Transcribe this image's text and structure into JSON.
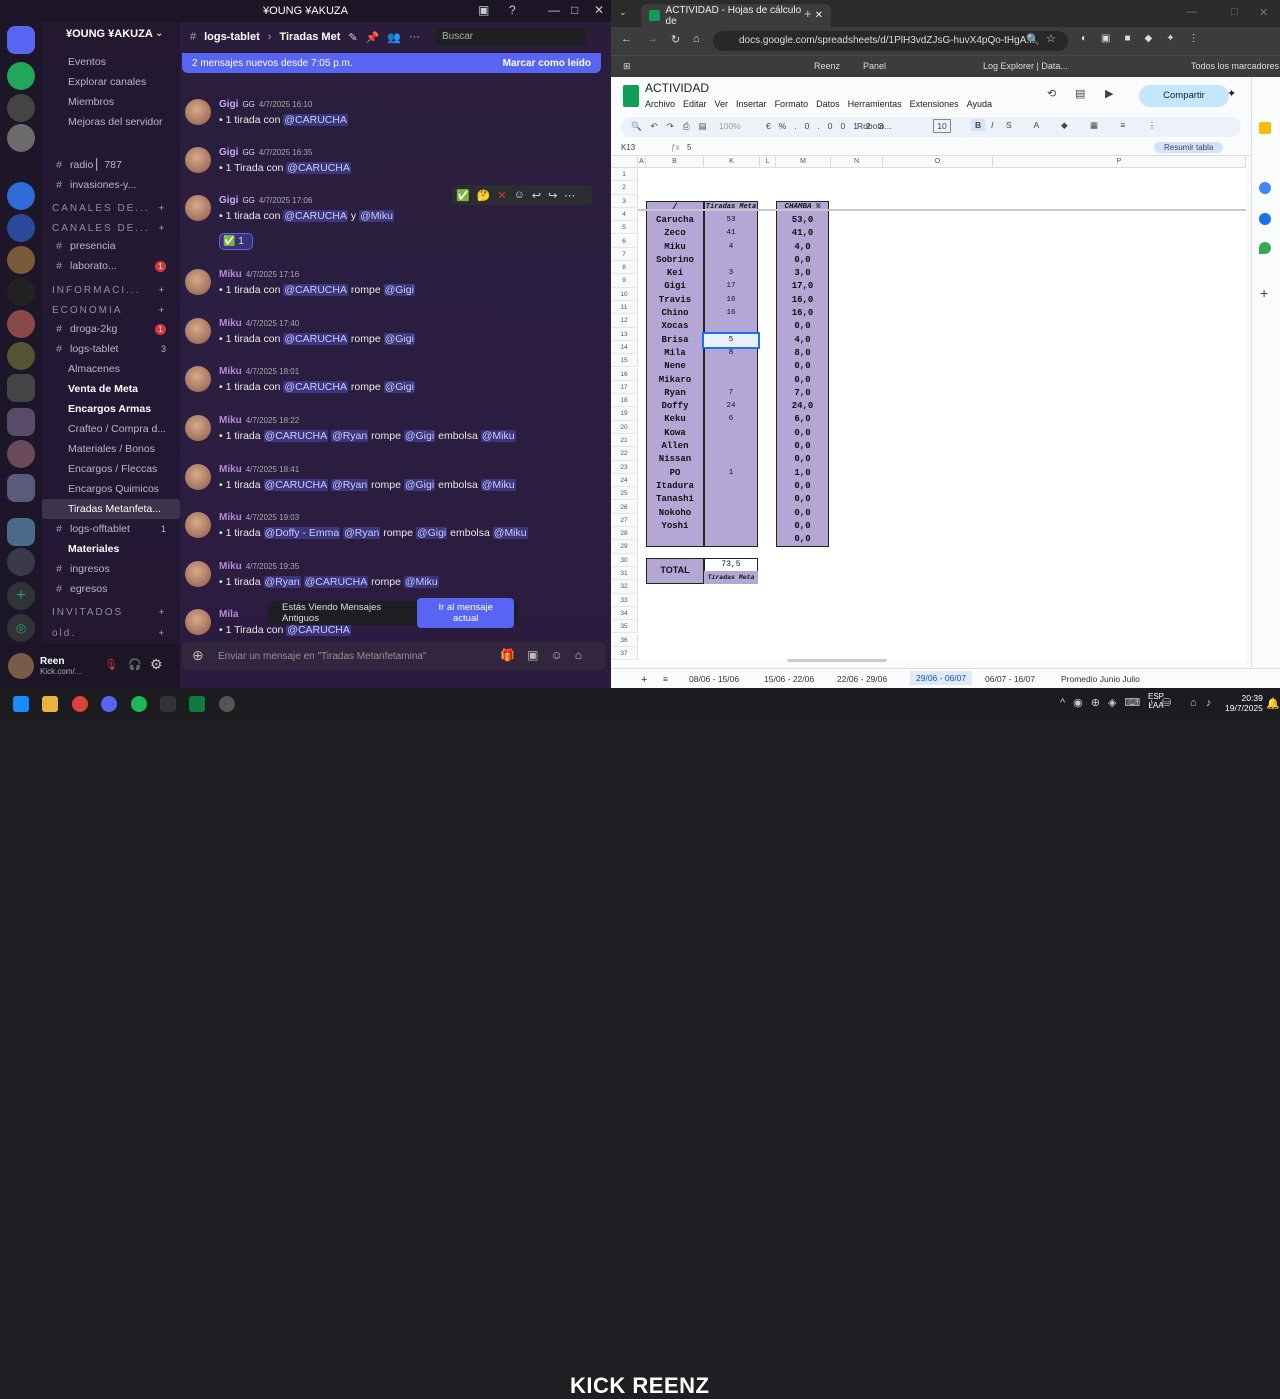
{
  "discord": {
    "title": "¥OUNG ¥AKUZA",
    "server_name": "¥OUNG ¥AKUZA",
    "channel_header": "logs-tablet",
    "thread_name": "Tiradas Met",
    "search_placeholder": "Buscar",
    "banner": {
      "text": "2 mensajes nuevos desde 7:05 p.m.",
      "action": "Marcar como leído"
    },
    "sidebar_top": [
      "Eventos",
      "Explorar canales",
      "Miembros",
      "Mejoras del servidor"
    ],
    "channels": [
      {
        "label": "radio ▏787",
        "icon": "#",
        "kind": "ch"
      },
      {
        "label": "invasiones-y...",
        "icon": "#",
        "kind": "ch"
      },
      {
        "label": "CANALES DE...",
        "icon": "",
        "kind": "cat"
      },
      {
        "label": "CANALES DE...",
        "icon": "",
        "kind": "cat"
      },
      {
        "label": "presencia",
        "icon": "#",
        "kind": "ch"
      },
      {
        "label": "laborato...",
        "icon": "#",
        "kind": "ch",
        "badge": "1"
      },
      {
        "label": "INFORMACI...",
        "icon": "",
        "kind": "cat"
      },
      {
        "label": "ECONOMIA",
        "icon": "",
        "kind": "cat"
      },
      {
        "label": "droga-2kg",
        "icon": "#",
        "kind": "ch",
        "badge": "1"
      },
      {
        "label": "logs-tablet",
        "icon": "#",
        "kind": "ch",
        "count": "3"
      },
      {
        "label": "Almacenes",
        "icon": "",
        "kind": "sub"
      },
      {
        "label": "Venta de Meta",
        "icon": "",
        "kind": "subbold"
      },
      {
        "label": "Encargos Armas",
        "icon": "",
        "kind": "subbold"
      },
      {
        "label": "Crafteo / Compra d...",
        "icon": "",
        "kind": "sub"
      },
      {
        "label": "Materiales / Bonos",
        "icon": "",
        "kind": "sub"
      },
      {
        "label": "Encargos / Fleccas",
        "icon": "",
        "kind": "sub"
      },
      {
        "label": "Encargos Quimicos",
        "icon": "",
        "kind": "sub"
      },
      {
        "label": "Tiradas Metanfeta...",
        "icon": "",
        "kind": "subsel"
      },
      {
        "label": "logs-offtablet",
        "icon": "#",
        "kind": "ch",
        "count": "1"
      },
      {
        "label": "Materiales",
        "icon": "",
        "kind": "subbold"
      },
      {
        "label": "ingresos",
        "icon": "#",
        "kind": "ch"
      },
      {
        "label": "egresos",
        "icon": "#",
        "kind": "ch"
      },
      {
        "label": "INVITADOS",
        "icon": "",
        "kind": "cat"
      },
      {
        "label": "old.",
        "icon": "",
        "kind": "cat"
      }
    ],
    "messages": [
      {
        "author": "Gigi",
        "tag": "GG",
        "time": "4/7/2025 16:10",
        "parts": [
          [
            "1 tirada con ",
            0
          ],
          [
            "@CARUCHA",
            1
          ]
        ]
      },
      {
        "author": "Gigi",
        "tag": "GG",
        "time": "4/7/2025 16:35",
        "parts": [
          [
            "1 Tirada con ",
            0
          ],
          [
            "@CARUCHA",
            1
          ]
        ]
      },
      {
        "author": "Gigi",
        "tag": "GG",
        "time": "4/7/2025 17:06",
        "parts": [
          [
            "1 tirada con ",
            0
          ],
          [
            "@CARUCHA",
            1
          ],
          [
            "  y ",
            0
          ],
          [
            "@Miku",
            1
          ]
        ]
      },
      {
        "author": "Miku",
        "tag": "",
        "time": "4/7/2025 17:16",
        "parts": [
          [
            "1 tirada con ",
            0
          ],
          [
            "@CARUCHA",
            1
          ],
          [
            " rompe ",
            0
          ],
          [
            "@Gigi",
            1
          ]
        ]
      },
      {
        "author": "Miku",
        "tag": "",
        "time": "4/7/2025 17:40",
        "parts": [
          [
            "1 tirada con ",
            0
          ],
          [
            "@CARUCHA",
            1
          ],
          [
            "  rompe ",
            0
          ],
          [
            "@Gigi",
            1
          ]
        ]
      },
      {
        "author": "Miku",
        "tag": "",
        "time": "4/7/2025 18:01",
        "parts": [
          [
            "1 tirada con ",
            0
          ],
          [
            "@CARUCHA",
            1
          ],
          [
            "  rompe ",
            0
          ],
          [
            "@Gigi",
            1
          ]
        ]
      },
      {
        "author": "Miku",
        "tag": "",
        "time": "4/7/2025 18:22",
        "parts": [
          [
            "1 tirada ",
            0
          ],
          [
            "@CARUCHA",
            1
          ],
          [
            " ",
            0
          ],
          [
            "@Ryan",
            1
          ],
          [
            " rompe ",
            0
          ],
          [
            "@Gigi",
            1
          ],
          [
            " embolsa ",
            0
          ],
          [
            "@Miku",
            1
          ]
        ]
      },
      {
        "author": "Miku",
        "tag": "",
        "time": "4/7/2025 18:41",
        "parts": [
          [
            "1 tirada ",
            0
          ],
          [
            "@CARUCHA",
            1
          ],
          [
            " ",
            0
          ],
          [
            "@Ryan",
            1
          ],
          [
            " rompe ",
            0
          ],
          [
            "@Gigi",
            1
          ],
          [
            " embolsa ",
            0
          ],
          [
            "@Miku",
            1
          ]
        ]
      },
      {
        "author": "Miku",
        "tag": "",
        "time": "4/7/2025 19:03",
        "parts": [
          [
            "1 tirada ",
            0
          ],
          [
            "@Doffy - Emma",
            1
          ],
          [
            " ",
            0
          ],
          [
            "@Ryan",
            1
          ],
          [
            " rompe ",
            0
          ],
          [
            "@Gigi",
            1
          ],
          [
            "  embolsa ",
            0
          ],
          [
            "@Miku",
            1
          ]
        ]
      },
      {
        "author": "Miku",
        "tag": "",
        "time": "4/7/2025 19:35",
        "parts": [
          [
            "1 tirada ",
            0
          ],
          [
            "@Ryan",
            1
          ],
          [
            "  ",
            0
          ],
          [
            "@CARUCHA",
            1
          ],
          [
            " rompe ",
            0
          ],
          [
            "@Miku",
            1
          ]
        ]
      },
      {
        "author": "Mila",
        "tag": "",
        "time": "",
        "parts": [
          [
            "1 Tirada con ",
            0
          ],
          [
            "@CARUCHA",
            1
          ]
        ]
      }
    ],
    "reaction_count": "1",
    "jump": {
      "text": "Estás Viendo Mensajes Antiguos",
      "button": "Ir al mensaje actual"
    },
    "composer_placeholder": "Enviar un mensaje en \"Tiradas Metanfetamina\"",
    "user": {
      "name": "Reen",
      "status": "Kick.com/..."
    }
  },
  "browser": {
    "tab_title": "ACTIVIDAD - Hojas de cálculo de",
    "url": "docs.google.com/spreadsheets/d/1PlH3vdZJsG-huvX4pQo-tHgA...",
    "bookmarks": [
      "Reenz",
      "Panel",
      "Log Explorer | Data...",
      "Todos los marcadores"
    ]
  },
  "sheet": {
    "doc_title": "ACTIVIDAD",
    "menus": [
      "Archivo",
      "Editar",
      "Ver",
      "Insertar",
      "Formato",
      "Datos",
      "Herramientas",
      "Extensiones",
      "Ayuda"
    ],
    "share": "Compartir",
    "zoom": "100%",
    "font": "Roboto...",
    "font_size": "10",
    "cell_ref": "K13",
    "formula": "5",
    "summarize": "Resumir tabla",
    "columns": [
      "A",
      "B",
      "K",
      "L",
      "M",
      "N",
      "O",
      "P"
    ],
    "header_name": "/",
    "header_tiradas": "Tiradas Meta",
    "header_chamba": "CHAMBA %",
    "rows": [
      {
        "name": "Carucha",
        "tiradas": "53",
        "chamba": "53,0"
      },
      {
        "name": "Zeco",
        "tiradas": "41",
        "chamba": "41,0"
      },
      {
        "name": "Miku",
        "tiradas": "4",
        "chamba": "4,0"
      },
      {
        "name": "Sobrino",
        "tiradas": "",
        "chamba": "0,0"
      },
      {
        "name": "Kei",
        "tiradas": "3",
        "chamba": "3,0"
      },
      {
        "name": "Gigi",
        "tiradas": "17",
        "chamba": "17,0"
      },
      {
        "name": "Travis",
        "tiradas": "16",
        "chamba": "16,0"
      },
      {
        "name": "Chino",
        "tiradas": "16",
        "chamba": "16,0"
      },
      {
        "name": "Xocas",
        "tiradas": "",
        "chamba": "0,0"
      },
      {
        "name": "Brisa",
        "tiradas": "5",
        "chamba": "4,0"
      },
      {
        "name": "Mila",
        "tiradas": "8",
        "chamba": "8,0"
      },
      {
        "name": "Nene",
        "tiradas": "",
        "chamba": "0,0"
      },
      {
        "name": "Mikaro",
        "tiradas": "",
        "chamba": "0,0"
      },
      {
        "name": "Ryan",
        "tiradas": "7",
        "chamba": "7,0"
      },
      {
        "name": "Doffy",
        "tiradas": "24",
        "chamba": "24,0"
      },
      {
        "name": "Keku",
        "tiradas": "6",
        "chamba": "6,0"
      },
      {
        "name": "Kowa",
        "tiradas": "",
        "chamba": "0,0"
      },
      {
        "name": "Allen",
        "tiradas": "",
        "chamba": "0,0"
      },
      {
        "name": "Nissan",
        "tiradas": "",
        "chamba": "0,0"
      },
      {
        "name": "PO",
        "tiradas": "1",
        "chamba": "1,0"
      },
      {
        "name": "Itadura",
        "tiradas": "",
        "chamba": "0,0"
      },
      {
        "name": "Tanashi",
        "tiradas": "",
        "chamba": "0,0"
      },
      {
        "name": "Nokoho",
        "tiradas": "",
        "chamba": "0,0"
      },
      {
        "name": "Yoshi",
        "tiradas": "",
        "chamba": "0,0"
      },
      {
        "name": "",
        "tiradas": "",
        "chamba": "0,0"
      }
    ],
    "total_label": "TOTAL",
    "total_value": "73,5",
    "total_sub": "Tiradas Meta",
    "tabs": [
      "08/06 - 15/06",
      "15/06 - 22/06",
      "22/06 - 29/06",
      "29/06 - 06/07",
      "06/07 - 16/07",
      "Promedio Junio Julio"
    ],
    "active_tab": "29/06 - 06/07"
  },
  "taskbar": {
    "lang": "ESP",
    "region": "LAA",
    "time": "20:39",
    "date": "19/7/2025"
  },
  "stream_overlay": "KICK REENZ"
}
